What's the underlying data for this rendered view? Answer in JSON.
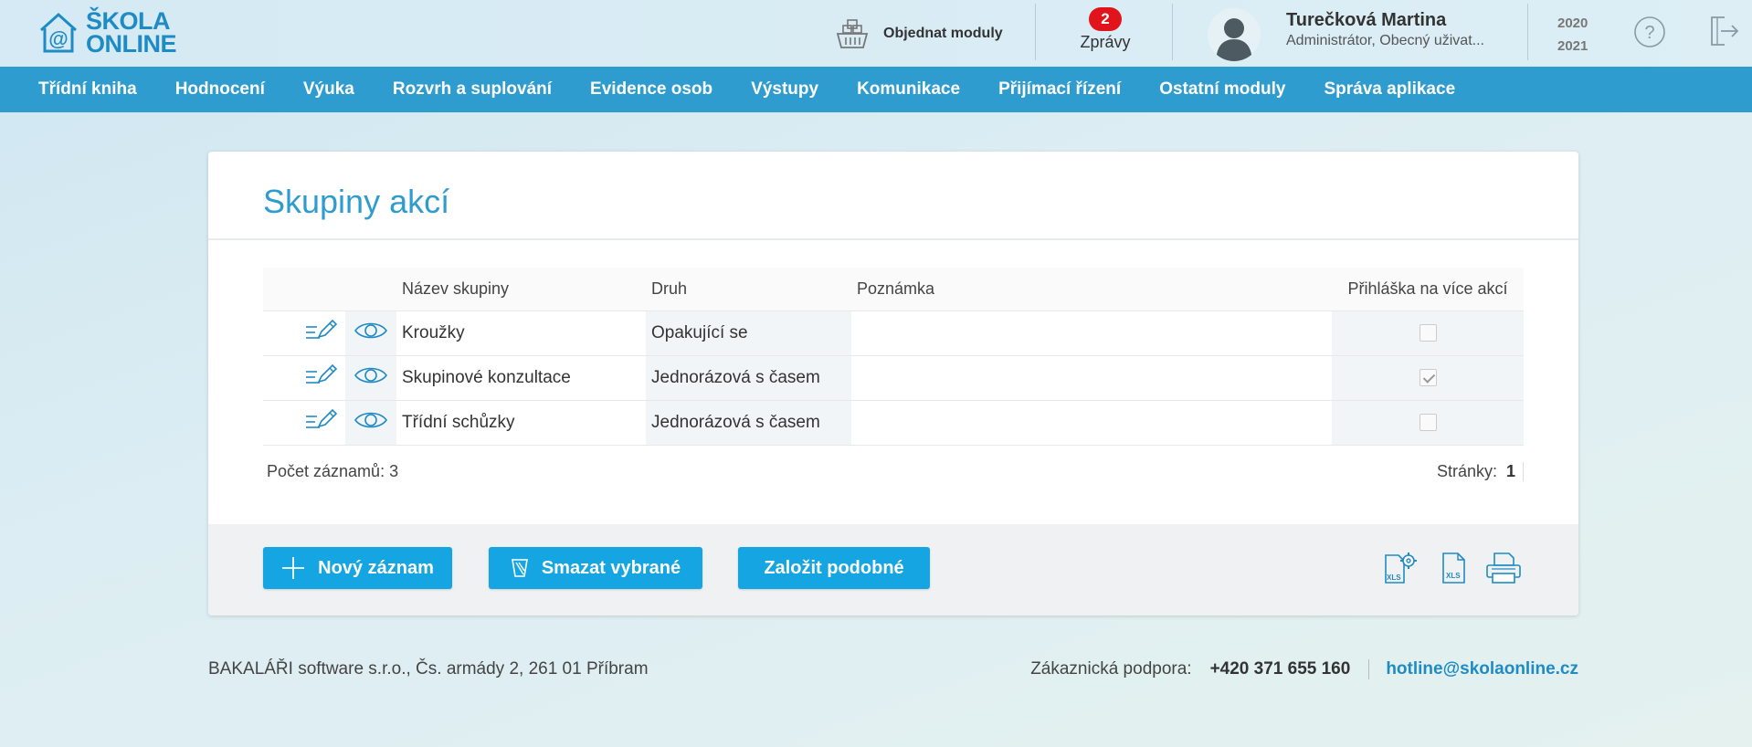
{
  "app": {
    "logo_line1": "ŠKOLA",
    "logo_line2": "ONLINE",
    "order_modules_label": "Objednat moduly",
    "messages": {
      "count": "2",
      "label": "Zprávy"
    },
    "user": {
      "name": "Turečková Martina",
      "role": "Administrátor, Obecný uživat..."
    },
    "school_year": {
      "from": "2020",
      "to": "2021"
    },
    "icons": {
      "help": "help-icon",
      "logout": "logout-icon",
      "basket": "basket-icon"
    }
  },
  "nav": {
    "items": [
      "Třídní kniha",
      "Hodnocení",
      "Výuka",
      "Rozvrh a suplování",
      "Evidence osob",
      "Výstupy",
      "Komunikace",
      "Přijímací řízení",
      "Ostatní moduly",
      "Správa aplikace"
    ]
  },
  "page": {
    "title": "Skupiny akcí",
    "table": {
      "headers": {
        "name": "Název skupiny",
        "kind": "Druh",
        "note": "Poznámka",
        "multi": "Přihláška na více akcí"
      },
      "rows": [
        {
          "name": "Kroužky",
          "kind": "Opakující se",
          "note": "",
          "multi": false
        },
        {
          "name": "Skupinové konzultace",
          "kind": "Jednorázová s časem",
          "note": "",
          "multi": true
        },
        {
          "name": "Třídní schůzky",
          "kind": "Jednorázová s časem",
          "note": "",
          "multi": false
        }
      ]
    },
    "record_count_label": "Počet záznamů: 3",
    "pages_label": "Stránky:",
    "current_page": "1",
    "buttons": {
      "new": "Nový záznam",
      "delete": "Smazat vybrané",
      "copy": "Založit podobné"
    }
  },
  "footer": {
    "company": "BAKALÁŘI software s.r.o., Čs. armády 2, 261 01 Příbram",
    "support_label": "Zákaznická podpora:",
    "phone": "+420 371 655 160",
    "email": "hotline@skolaonline.cz"
  },
  "colors": {
    "accent": "#2f9ccf",
    "button": "#14a5e2",
    "badge": "#e1141b",
    "title": "#2f9ccf"
  }
}
